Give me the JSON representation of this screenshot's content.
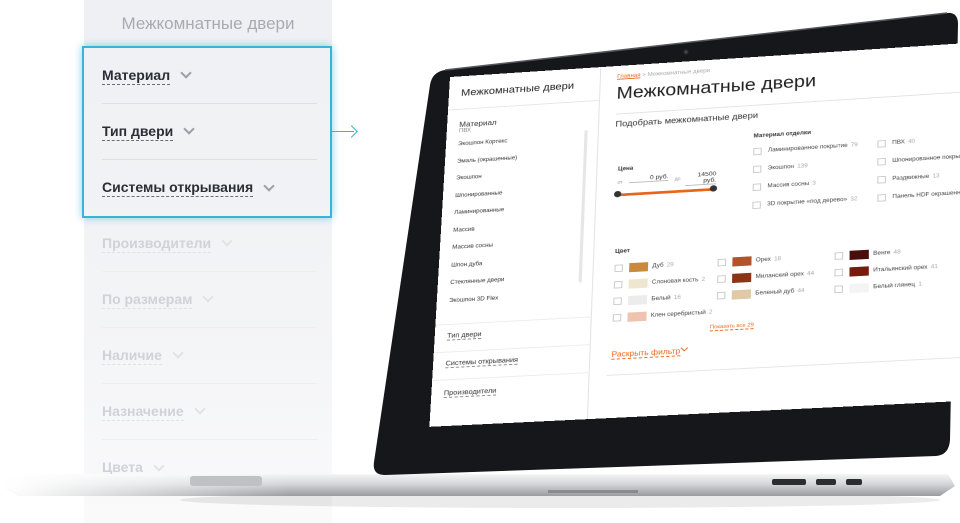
{
  "panel": {
    "title": "Межкомнатные двери",
    "items": [
      {
        "label": "Материал"
      },
      {
        "label": "Тип двери"
      },
      {
        "label": "Системы открывания"
      },
      {
        "label": "Производители"
      },
      {
        "label": "По размерам"
      },
      {
        "label": "Наличие"
      },
      {
        "label": "Назначение"
      },
      {
        "label": "Цвета"
      }
    ]
  },
  "site": {
    "sidebar": {
      "title": "Межкомнатные двери",
      "material_heading": "Материал",
      "material_sub": "ПВХ",
      "material_items": [
        "Экошпон Кортекс",
        "Эмаль (окрашенные)",
        "Экошпон",
        "Шпонированные",
        "Ламинированные",
        "Массив",
        "Массив сосны",
        "Шпон дуба",
        "Стеклянные двери",
        "Экошпон 3D Flex"
      ],
      "sections": [
        "Тип двери",
        "Системы открывания",
        "Производители"
      ]
    },
    "breadcrumb": {
      "home": "Главная",
      "separator": ">",
      "current": "Межкомнатные двери"
    },
    "heading": "Межкомнатные двери",
    "subheading": "Подобрать межкомнатные двери",
    "price": {
      "label": "Цена",
      "from_label": "от",
      "from_value": "0 руб.",
      "to_label": "до",
      "to_value": "14500 руб."
    },
    "material_finish": {
      "title": "Материал отделки",
      "left": [
        {
          "label": "Ламинированное покрытие",
          "count": "79"
        },
        {
          "label": "Экошпон",
          "count": "139"
        },
        {
          "label": "Массив сосны",
          "count": "3"
        },
        {
          "label": "3D покрытие «под дерево»",
          "count": "32"
        }
      ],
      "right": [
        {
          "label": "ПВХ",
          "count": "40"
        },
        {
          "label": "Шпонированное покрытие",
          "count": "35"
        },
        {
          "label": "Раздвижные",
          "count": "13"
        },
        {
          "label": "Панель HDF окрашенная",
          "count": "4"
        }
      ]
    },
    "colors": {
      "title": "Цвет",
      "col1": [
        {
          "label": "Дуб",
          "count": "29",
          "color": "#c98a3e"
        },
        {
          "label": "Слоновая кость",
          "count": "2",
          "color": "#efe6cf"
        },
        {
          "label": "Белый",
          "count": "16",
          "color": "#ececec"
        },
        {
          "label": "Клен серебристый",
          "count": "2",
          "color": "#eec3b0"
        }
      ],
      "col2": [
        {
          "label": "Орех",
          "count": "18",
          "color": "#b2542a"
        },
        {
          "label": "Миланский орех",
          "count": "44",
          "color": "#8b3416"
        },
        {
          "label": "Беленый дуб",
          "count": "44",
          "color": "#e0c9a6"
        }
      ],
      "col3": [
        {
          "label": "Венге",
          "count": "48",
          "color": "#4a0d0d"
        },
        {
          "label": "Итальянский орех",
          "count": "41",
          "color": "#7a1a0c"
        },
        {
          "label": "Белый глянец",
          "count": "1",
          "color": "#f4f4f4"
        }
      ],
      "show_all": "Показать все",
      "show_all_count": "29"
    },
    "expand_filter": "Раскрыть фильтр",
    "accent": "#e8661c"
  },
  "colors": {
    "highlight": "#39b4d6"
  }
}
